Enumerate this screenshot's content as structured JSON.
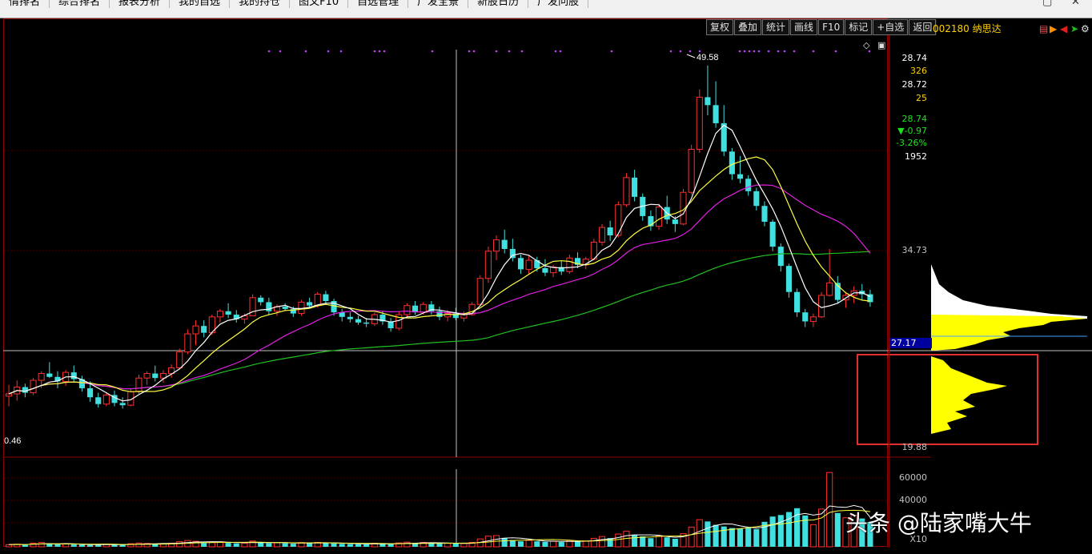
{
  "nav": {
    "items": [
      "情排名",
      "综合排名",
      "报表分析",
      "我的自选",
      "我的持仓",
      "图文F10",
      "自选管理",
      "广发全景",
      "新股日历",
      "广发问股"
    ]
  },
  "window_controls": {
    "restore": "▢",
    "close": "✕"
  },
  "toolbar": {
    "buttons": [
      "复权",
      "叠加",
      "统计",
      "画线",
      "F10",
      "标记",
      "+自选",
      "返回"
    ]
  },
  "stock": {
    "code": "002180",
    "name": "纳思达"
  },
  "header_icons": [
    "settings-icon",
    "arrow-right-icon",
    "arrow-left-icon",
    "back-arrow-icon",
    "tools-icon"
  ],
  "price_panel": {
    "labels": [
      {
        "text": "28.74",
        "color": "#ffffff"
      },
      {
        "text": "326",
        "color": "#ffd000"
      },
      {
        "text": "28.72",
        "color": "#ffffff"
      },
      {
        "text": "25",
        "color": "#ffd000"
      },
      {
        "text": "28.74",
        "color": "#20e020"
      },
      {
        "text": "▼-0.97",
        "color": "#20e020"
      },
      {
        "text": "-3.26%",
        "color": "#20e020"
      },
      {
        "text": "1952",
        "color": "#ffffff"
      }
    ],
    "axis": {
      "upper": "34.73",
      "cursor": "27.17",
      "lower": "19.88",
      "hidden": "27.33"
    }
  },
  "chart_annotations": {
    "high": "49.58",
    "low": "0.46"
  },
  "volume_axis": {
    "labels": [
      "60000",
      "40000"
    ],
    "unit": "X10"
  },
  "watermark": "头条 @陆家嘴大牛",
  "colors": {
    "up": "#ff3030",
    "down": "#40e0e0",
    "ma5": "#ffffff",
    "ma10": "#ffff40",
    "ma20": "#e020e0",
    "ma60": "#20c020",
    "chip": "#ffff00",
    "highlight_box": "#e03030"
  },
  "chart_data": {
    "type": "candlestick",
    "ylim": [
      16.5,
      51.0
    ],
    "candles": [
      [
        20.4,
        21.4,
        19.5,
        20.6
      ],
      [
        20.6,
        21.8,
        20.0,
        21.2
      ],
      [
        21.2,
        21.5,
        20.3,
        20.7
      ],
      [
        20.7,
        22.0,
        20.5,
        21.8
      ],
      [
        21.8,
        22.6,
        21.1,
        22.4
      ],
      [
        22.4,
        23.4,
        22.0,
        22.1
      ],
      [
        22.1,
        22.6,
        21.1,
        21.7
      ],
      [
        21.7,
        22.7,
        21.3,
        22.5
      ],
      [
        22.5,
        23.1,
        21.6,
        21.9
      ],
      [
        21.9,
        22.2,
        20.8,
        21.1
      ],
      [
        21.1,
        21.7,
        19.9,
        20.3
      ],
      [
        20.3,
        20.7,
        19.4,
        19.7
      ],
      [
        19.7,
        20.7,
        19.5,
        20.5
      ],
      [
        20.5,
        20.9,
        19.5,
        19.8
      ],
      [
        19.8,
        20.3,
        19.3,
        19.6
      ],
      [
        19.6,
        21.1,
        19.5,
        20.8
      ],
      [
        20.8,
        22.3,
        20.6,
        22.0
      ],
      [
        22.0,
        22.6,
        21.4,
        22.4
      ],
      [
        22.4,
        23.1,
        21.7,
        22.0
      ],
      [
        22.0,
        22.7,
        21.6,
        22.4
      ],
      [
        22.4,
        23.2,
        22.0,
        22.9
      ],
      [
        22.9,
        24.6,
        22.8,
        24.3
      ],
      [
        24.3,
        26.3,
        24.1,
        25.9
      ],
      [
        25.9,
        27.1,
        24.9,
        26.6
      ],
      [
        26.6,
        27.1,
        25.6,
        26.0
      ],
      [
        26.0,
        27.6,
        25.8,
        27.4
      ],
      [
        27.4,
        28.1,
        26.9,
        27.9
      ],
      [
        27.9,
        28.6,
        27.3,
        27.6
      ],
      [
        27.6,
        28.0,
        26.9,
        27.2
      ],
      [
        27.2,
        27.7,
        26.8,
        27.5
      ],
      [
        27.5,
        29.4,
        27.5,
        29.1
      ],
      [
        29.1,
        29.3,
        28.4,
        28.7
      ],
      [
        28.7,
        29.1,
        27.6,
        27.9
      ],
      [
        27.9,
        28.5,
        27.5,
        28.3
      ],
      [
        28.3,
        28.6,
        27.9,
        28.1
      ],
      [
        28.1,
        28.3,
        27.4,
        27.7
      ],
      [
        27.7,
        28.9,
        27.5,
        28.7
      ],
      [
        28.7,
        29.1,
        28.2,
        28.4
      ],
      [
        28.4,
        29.6,
        28.2,
        29.4
      ],
      [
        29.4,
        29.7,
        28.5,
        28.8
      ],
      [
        28.8,
        29.0,
        27.5,
        27.8
      ],
      [
        27.8,
        28.1,
        27.0,
        27.4
      ],
      [
        27.4,
        27.8,
        26.9,
        27.2
      ],
      [
        27.2,
        27.5,
        26.7,
        26.9
      ],
      [
        26.9,
        27.3,
        26.5,
        26.8
      ],
      [
        26.8,
        27.8,
        26.6,
        27.6
      ],
      [
        27.6,
        27.9,
        26.7,
        27.0
      ],
      [
        27.0,
        27.3,
        26.1,
        26.4
      ],
      [
        26.4,
        27.9,
        26.2,
        27.6
      ],
      [
        27.6,
        28.6,
        27.4,
        28.4
      ],
      [
        28.4,
        28.8,
        27.6,
        27.8
      ],
      [
        27.8,
        28.7,
        27.6,
        28.5
      ],
      [
        28.5,
        28.8,
        27.6,
        27.9
      ],
      [
        27.9,
        28.3,
        27.1,
        27.4
      ],
      [
        27.4,
        28.0,
        27.0,
        27.7
      ],
      [
        27.7,
        28.2,
        27.1,
        27.3
      ],
      [
        27.3,
        27.9,
        27.0,
        27.6
      ],
      [
        27.6,
        28.7,
        27.5,
        28.5
      ],
      [
        28.5,
        31.1,
        28.4,
        30.8
      ],
      [
        30.8,
        33.6,
        30.4,
        33.2
      ],
      [
        33.2,
        34.6,
        32.4,
        34.2
      ],
      [
        34.2,
        35.1,
        33.0,
        33.4
      ],
      [
        33.4,
        34.3,
        32.3,
        32.6
      ],
      [
        32.6,
        32.9,
        31.2,
        31.6
      ],
      [
        31.6,
        32.8,
        31.2,
        32.4
      ],
      [
        32.4,
        32.7,
        31.4,
        31.7
      ],
      [
        31.7,
        32.5,
        31.0,
        31.3
      ],
      [
        31.3,
        32.0,
        30.9,
        31.8
      ],
      [
        31.8,
        32.3,
        31.1,
        31.4
      ],
      [
        31.4,
        32.9,
        31.2,
        32.6
      ],
      [
        32.6,
        33.1,
        31.7,
        32.0
      ],
      [
        32.0,
        32.7,
        31.6,
        32.5
      ],
      [
        32.5,
        34.3,
        32.4,
        34.0
      ],
      [
        34.0,
        35.6,
        33.7,
        35.3
      ],
      [
        35.3,
        35.9,
        34.1,
        34.6
      ],
      [
        34.6,
        37.6,
        34.4,
        37.3
      ],
      [
        37.3,
        40.1,
        37.1,
        39.7
      ],
      [
        39.7,
        40.4,
        37.6,
        38.0
      ],
      [
        38.0,
        38.3,
        35.9,
        36.3
      ],
      [
        36.3,
        36.8,
        35.0,
        35.4
      ],
      [
        35.4,
        37.4,
        35.1,
        37.1
      ],
      [
        37.1,
        38.1,
        35.6,
        36.0
      ],
      [
        36.0,
        36.3,
        34.9,
        35.6
      ],
      [
        35.6,
        38.7,
        35.5,
        38.4
      ],
      [
        38.4,
        42.6,
        38.2,
        42.2
      ],
      [
        42.2,
        47.5,
        41.9,
        46.8
      ],
      [
        46.8,
        49.6,
        45.2,
        46.1
      ],
      [
        46.1,
        48.2,
        44.1,
        44.5
      ],
      [
        44.5,
        46.1,
        41.6,
        42.0
      ],
      [
        42.0,
        42.3,
        39.5,
        40.0
      ],
      [
        40.0,
        41.6,
        39.2,
        39.6
      ],
      [
        39.6,
        39.9,
        38.1,
        38.5
      ],
      [
        38.5,
        38.8,
        36.8,
        37.2
      ],
      [
        37.2,
        37.6,
        35.4,
        35.8
      ],
      [
        35.8,
        36.0,
        33.2,
        33.6
      ],
      [
        33.6,
        33.9,
        31.4,
        31.9
      ],
      [
        31.9,
        32.1,
        29.1,
        29.6
      ],
      [
        29.6,
        29.9,
        27.4,
        27.8
      ],
      [
        27.8,
        28.1,
        26.5,
        27.0
      ],
      [
        27.0,
        27.7,
        26.5,
        27.4
      ],
      [
        27.4,
        29.6,
        27.3,
        29.3
      ],
      [
        29.3,
        33.4,
        29.2,
        30.4
      ],
      [
        30.4,
        31.0,
        28.6,
        28.9
      ],
      [
        28.9,
        29.6,
        28.2,
        29.3
      ],
      [
        29.3,
        30.1,
        28.6,
        29.7
      ],
      [
        29.7,
        30.3,
        28.9,
        29.4
      ],
      [
        29.4,
        29.8,
        28.3,
        28.7
      ]
    ],
    "volume": [
      1800,
      2200,
      1500,
      3100,
      3600,
      2500,
      2000,
      2300,
      1900,
      1700,
      1500,
      1900,
      2100,
      1700,
      1600,
      2600,
      3200,
      2800,
      2500,
      2700,
      3000,
      4400,
      5300,
      4600,
      3100,
      4000,
      4200,
      3300,
      2800,
      3000,
      4800,
      3600,
      3100,
      3300,
      3000,
      2600,
      3600,
      3300,
      3700,
      3200,
      2800,
      2500,
      2300,
      2200,
      2100,
      3000,
      2400,
      2200,
      3300,
      3900,
      3200,
      3700,
      3100,
      2700,
      2900,
      2700,
      2900,
      3700,
      6600,
      8900,
      9400,
      7500,
      5600,
      4600,
      5300,
      4600,
      4200,
      4600,
      4000,
      5300,
      4600,
      4900,
      7100,
      8600,
      7300,
      10700,
      13000,
      10200,
      8700,
      7200,
      9300,
      7900,
      6700,
      11000,
      16500,
      22700,
      21200,
      18400,
      17000,
      15700,
      15100,
      16000,
      14800,
      20900,
      25300,
      26600,
      29100,
      32300,
      26200,
      18500,
      31600,
      62200,
      28300,
      24300,
      26400,
      23700,
      20800
    ],
    "overlays": {
      "ma5": "white",
      "ma10": "yellow",
      "ma20": "magenta",
      "ma60": "green"
    }
  }
}
